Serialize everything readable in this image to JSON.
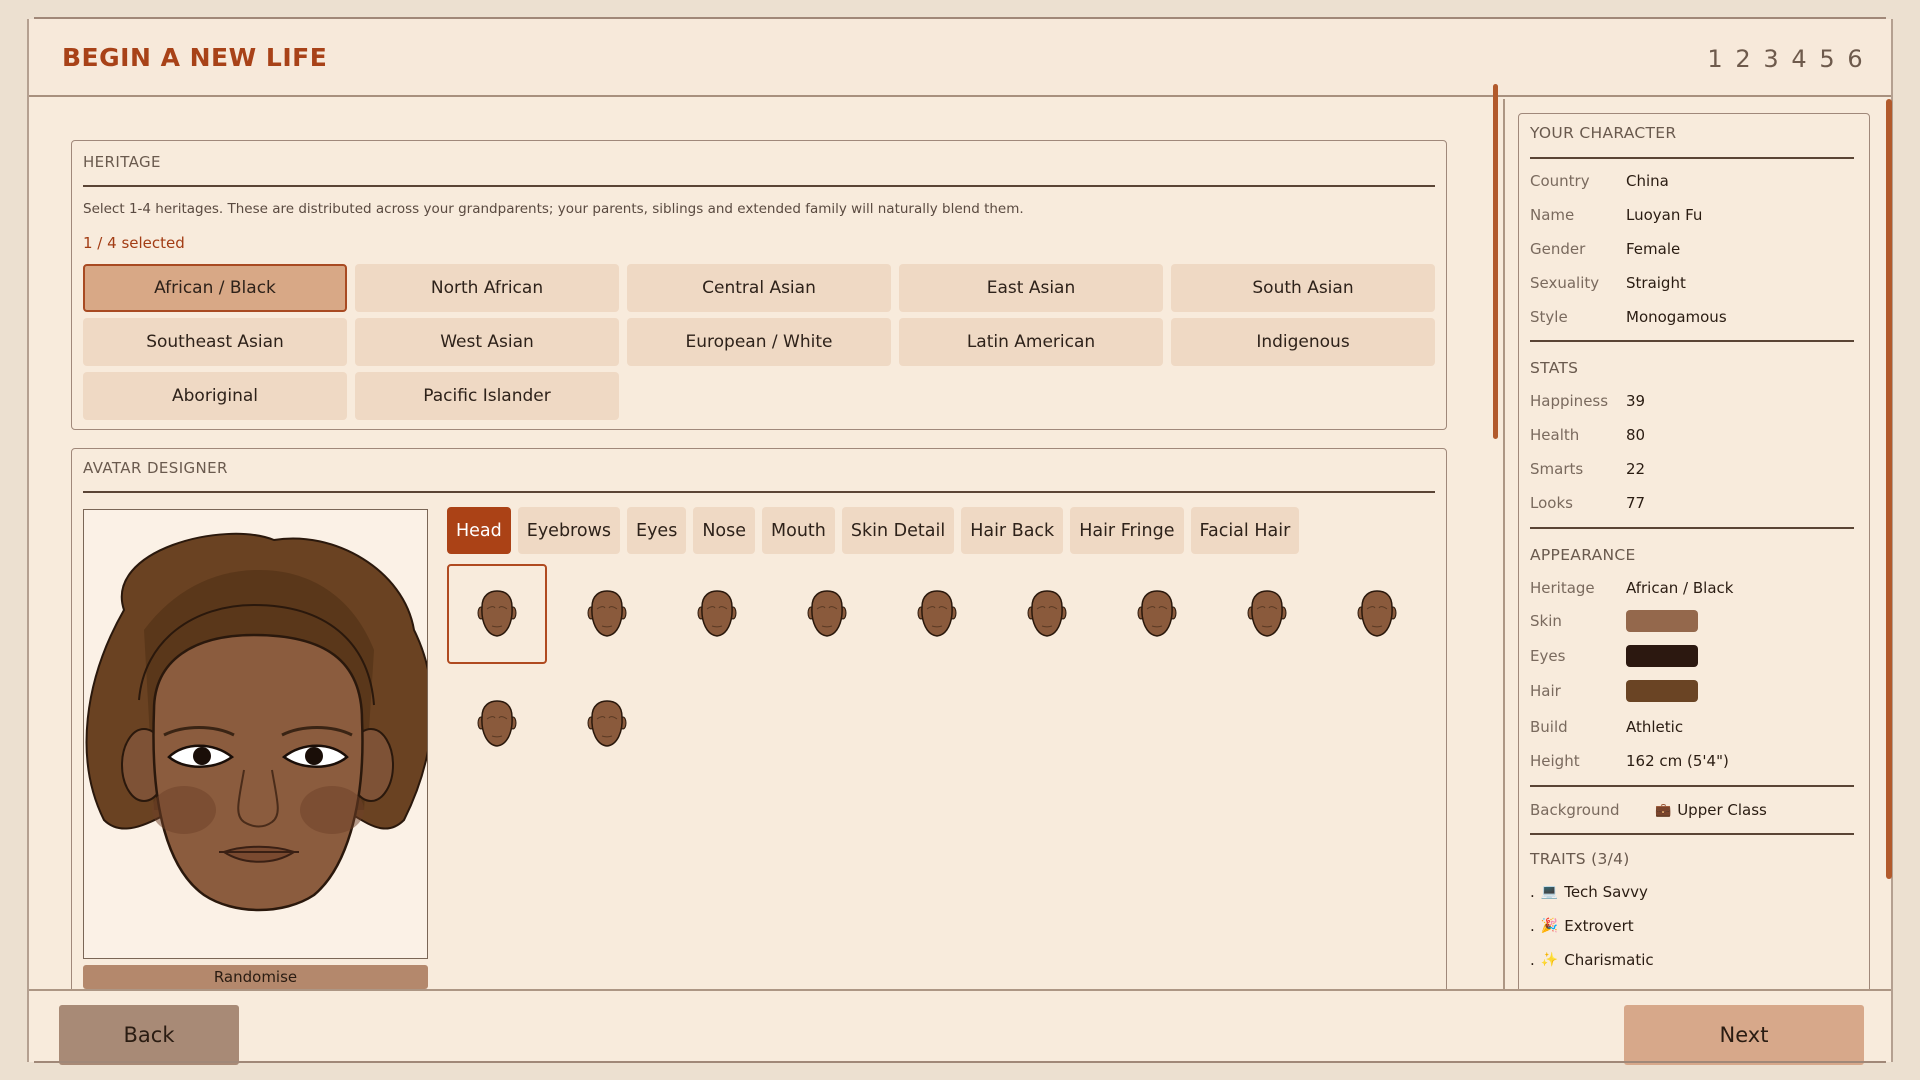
{
  "header": {
    "title": "BEGIN A NEW LIFE",
    "steps": [
      "1",
      "2",
      "3",
      "4",
      "5",
      "6"
    ]
  },
  "heritage": {
    "title": "HERITAGE",
    "description": "Select 1-4 heritages. These are distributed across your grandparents; your parents, siblings and extended family will naturally blend them.",
    "count": "1 / 4 selected",
    "options": [
      {
        "label": "African / Black",
        "selected": true
      },
      {
        "label": "North African",
        "selected": false
      },
      {
        "label": "Central Asian",
        "selected": false
      },
      {
        "label": "East Asian",
        "selected": false
      },
      {
        "label": "South Asian",
        "selected": false
      },
      {
        "label": "Southeast Asian",
        "selected": false
      },
      {
        "label": "West Asian",
        "selected": false
      },
      {
        "label": "European / White",
        "selected": false
      },
      {
        "label": "Latin American",
        "selected": false
      },
      {
        "label": "Indigenous",
        "selected": false
      },
      {
        "label": "Aboriginal",
        "selected": false
      },
      {
        "label": "Pacific Islander",
        "selected": false
      }
    ]
  },
  "avatar": {
    "title": "AVATAR DESIGNER",
    "randomise_label": "Randomise",
    "tabs": [
      {
        "label": "Head",
        "active": true
      },
      {
        "label": "Eyebrows",
        "active": false
      },
      {
        "label": "Eyes",
        "active": false
      },
      {
        "label": "Nose",
        "active": false
      },
      {
        "label": "Mouth",
        "active": false
      },
      {
        "label": "Skin Detail",
        "active": false
      },
      {
        "label": "Hair Back",
        "active": false
      },
      {
        "label": "Hair Fringe",
        "active": false
      },
      {
        "label": "Facial Hair",
        "active": false
      }
    ],
    "head_option_count": 11,
    "selected_head_index": 0,
    "colors": {
      "skin": "#8a5a3c",
      "hair": "#5e3a1c",
      "eyes": "#2a1812"
    }
  },
  "character": {
    "title": "YOUR CHARACTER",
    "info": [
      {
        "label": "Country",
        "value": "China"
      },
      {
        "label": "Name",
        "value": "Luoyan Fu"
      },
      {
        "label": "Gender",
        "value": "Female"
      },
      {
        "label": "Sexuality",
        "value": "Straight"
      },
      {
        "label": "Style",
        "value": "Monogamous"
      }
    ],
    "stats_title": "STATS",
    "stats": [
      {
        "label": "Happiness",
        "value": "39"
      },
      {
        "label": "Health",
        "value": "80"
      },
      {
        "label": "Smarts",
        "value": "22"
      },
      {
        "label": "Looks",
        "value": "77"
      }
    ],
    "appearance_title": "APPEARANCE",
    "heritage": {
      "label": "Heritage",
      "value": "African / Black"
    },
    "swatches": [
      {
        "label": "Skin",
        "color": "#94684c"
      },
      {
        "label": "Eyes",
        "color": "#2c1810"
      },
      {
        "label": "Hair",
        "color": "#6a4424"
      }
    ],
    "build": {
      "label": "Build",
      "value": "Athletic"
    },
    "height": {
      "label": "Height",
      "value": "162 cm (5'4\")"
    },
    "background": {
      "label": "Background",
      "icon": "briefcase-icon",
      "value": "Upper Class"
    },
    "traits_title": "TRAITS (3/4)",
    "traits": [
      {
        "icon": "computer-icon",
        "glyph": "💻",
        "label": "Tech Savvy"
      },
      {
        "icon": "party-popper-icon",
        "glyph": "🎉",
        "label": "Extrovert"
      },
      {
        "icon": "sparkles-icon",
        "glyph": "✨",
        "label": "Charismatic"
      }
    ]
  },
  "nav": {
    "back_label": "Back",
    "next_label": "Next"
  }
}
